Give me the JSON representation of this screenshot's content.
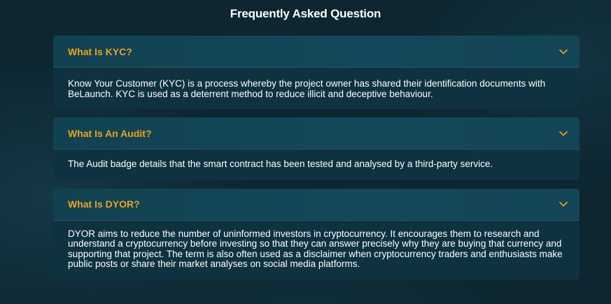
{
  "page": {
    "title": "Frequently Asked Question"
  },
  "faq": {
    "items": [
      {
        "question": "What Is KYC?",
        "answer": "Know Your Customer (KYC) is a process whereby the project owner has shared their identification documents with BeLaunch. KYC is used as a deterrent method to reduce illicit and deceptive behaviour.",
        "expanded": true
      },
      {
        "question": "What Is An Audit?",
        "answer": "The Audit badge details that the smart contract has been tested and analysed by a third-party service.",
        "expanded": true
      },
      {
        "question": "What Is DYOR?",
        "answer": "DYOR aims to reduce the number of uninformed investors in cryptocurrency. It encourages them to research and understand a cryptocurrency before investing so that they can answer precisely why they are buying that currency and supporting that project. The term is also often used as a disclaimer when cryptocurrency traders and enthusiasts make public posts or share their market analyses on social media platforms.",
        "expanded": true
      }
    ]
  },
  "colors": {
    "question": "#f0a21b",
    "background": "#0d2630",
    "card": "#103744",
    "text": "#ffffff"
  },
  "icons": {
    "toggle": "chevron-down-icon"
  }
}
